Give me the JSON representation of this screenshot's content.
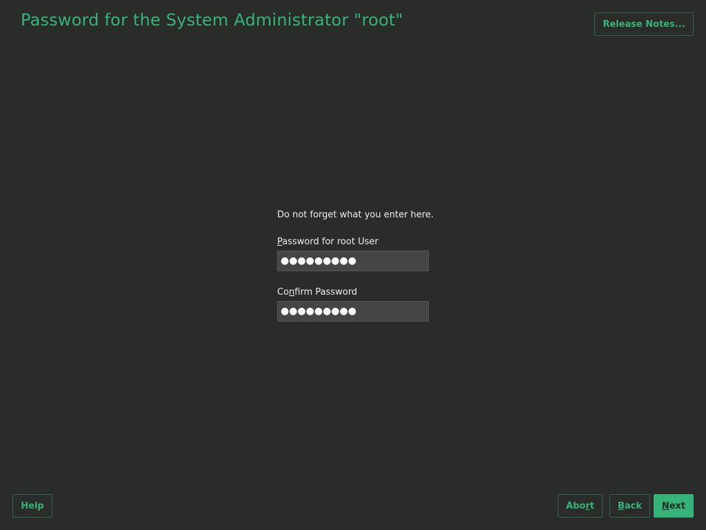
{
  "header": {
    "title": "Password for the System Administrator \"root\"",
    "release_notes_label": "Release Notes..."
  },
  "form": {
    "info_text": "Do not forget what you enter here.",
    "password_label": {
      "mnemonic": "P",
      "rest": "assword for root User"
    },
    "password_value": "●●●●●●●●●",
    "confirm_label": {
      "before": "Co",
      "mnemonic": "n",
      "rest": "firm Password"
    },
    "confirm_value": "●●●●●●●●●"
  },
  "footer": {
    "help_label": "Help",
    "abort_label": {
      "before": "Abo",
      "mnemonic": "r",
      "rest": "t"
    },
    "back_label": {
      "mnemonic": "B",
      "rest": "ack"
    },
    "next_label": {
      "mnemonic": "N",
      "rest": "ext"
    }
  },
  "colors": {
    "background": "#2a2c29",
    "accent": "#35b379",
    "text": "#eeeeee",
    "input_bg": "#444643"
  }
}
